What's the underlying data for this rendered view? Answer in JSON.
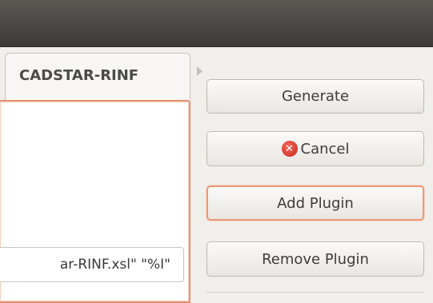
{
  "tabs": {
    "active_label": "CADSTAR-RINF"
  },
  "command_field": {
    "visible_text": "ar-RINF.xsl\" \"%I\""
  },
  "buttons": {
    "generate_label": "Generate",
    "cancel_label": "Cancel",
    "add_plugin_label": "Add Plugin",
    "remove_plugin_label": "Remove Plugin"
  },
  "colors": {
    "focus_accent": "#e8926e",
    "cancel_icon": "#d9382a",
    "titlebar": "#4a4844"
  },
  "icons": {
    "cancel": "close-circle-icon",
    "tab_scroll": "chevron-right-icon"
  }
}
